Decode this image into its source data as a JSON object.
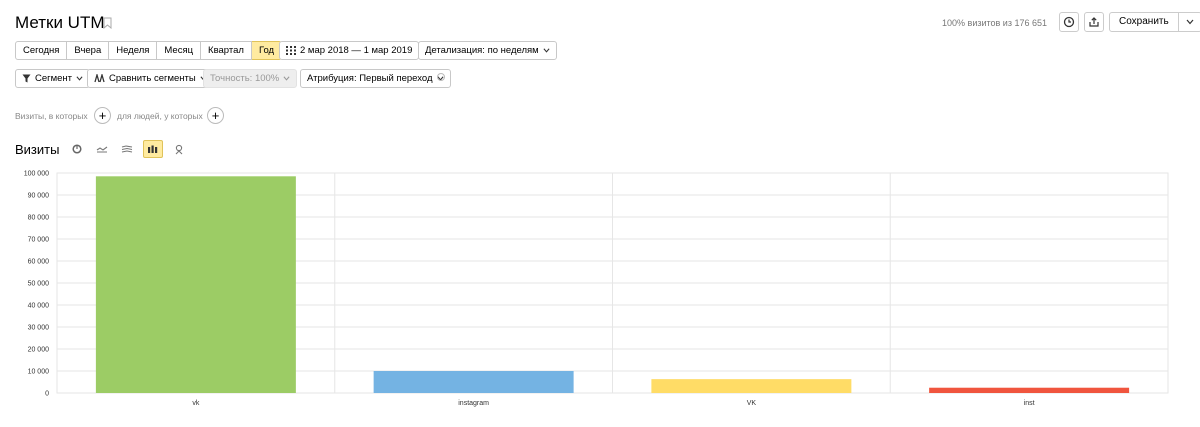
{
  "header": {
    "title": "Метки UTM",
    "visits_summary": "100% визитов из 176 651",
    "save_label": "Сохранить"
  },
  "period": {
    "buttons": [
      "Сегодня",
      "Вчера",
      "Неделя",
      "Месяц",
      "Квартал",
      "Год"
    ],
    "active": "Год",
    "date_range": "2 мар 2018 — 1 мар 2019",
    "detail": "Детализация: по неделям"
  },
  "toolbar": {
    "segment": "Сегмент",
    "compare": "Сравнить сегменты",
    "accuracy": "Точность: 100%",
    "attribution": "Атрибуция: Первый переход"
  },
  "filters": {
    "visits_label": "Визиты, в которых",
    "people_label": "для людей, у которых"
  },
  "chart": {
    "label": "Визиты",
    "type_icons": [
      "pie-chart-icon",
      "line-chart-icon",
      "area-chart-icon",
      "bar-chart-icon",
      "map-icon"
    ],
    "active_type": "bar-chart-icon"
  },
  "chart_data": {
    "type": "bar",
    "categories": [
      "vk",
      "instagram",
      "VK",
      "inst"
    ],
    "values": [
      98500,
      10000,
      6300,
      2400
    ],
    "colors": [
      "#9ccc65",
      "#74b3e3",
      "#ffdc66",
      "#f0553e"
    ],
    "ylim": [
      0,
      100000
    ],
    "yticks": [
      "0",
      "10 000",
      "20 000",
      "30 000",
      "40 000",
      "50 000",
      "60 000",
      "70 000",
      "80 000",
      "90 000",
      "100 000"
    ],
    "grid": true
  }
}
